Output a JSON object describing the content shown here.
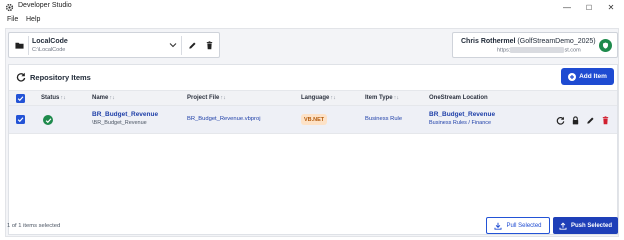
{
  "window": {
    "title": "Developer Studio",
    "controls": {
      "minimize": "—",
      "maximize": "☐",
      "close": "✕"
    }
  },
  "menu": {
    "items": [
      "File",
      "Help"
    ]
  },
  "workspace": {
    "name": "LocalCode",
    "path": "C:\\LocalCode"
  },
  "user": {
    "name": "Chris Rothermel",
    "connection": "(GolfStreamDemo_2025)",
    "url_prefix": "https:",
    "url_suffix": "st.com"
  },
  "repo": {
    "title": "Repository Items",
    "add_label": "Add Item",
    "columns": {
      "status": "Status",
      "name": "Name",
      "project_file": "Project File",
      "language": "Language",
      "item_type": "Item Type",
      "location": "OneStream Location"
    },
    "sort_indicator": "↑↓",
    "rows": [
      {
        "name": "BR_Budget_Revenue",
        "sub": "\\BR_Budget_Revenue",
        "project_file": "BR_Budget_Revenue.vbproj",
        "language": "VB.NET",
        "item_type": "Business Rule",
        "location": "BR_Budget_Revenue",
        "location_path": "Business Rules / Finance"
      }
    ]
  },
  "footer": {
    "selection": "1 of 1 items selected",
    "pull_label": "Pull Selected",
    "push_label": "Push Selected"
  },
  "colors": {
    "accent": "#1e4bd2",
    "success": "#1e8a4c",
    "danger": "#d11f2f",
    "badge_bg": "#fde2c7",
    "badge_fg": "#b35b0d"
  }
}
